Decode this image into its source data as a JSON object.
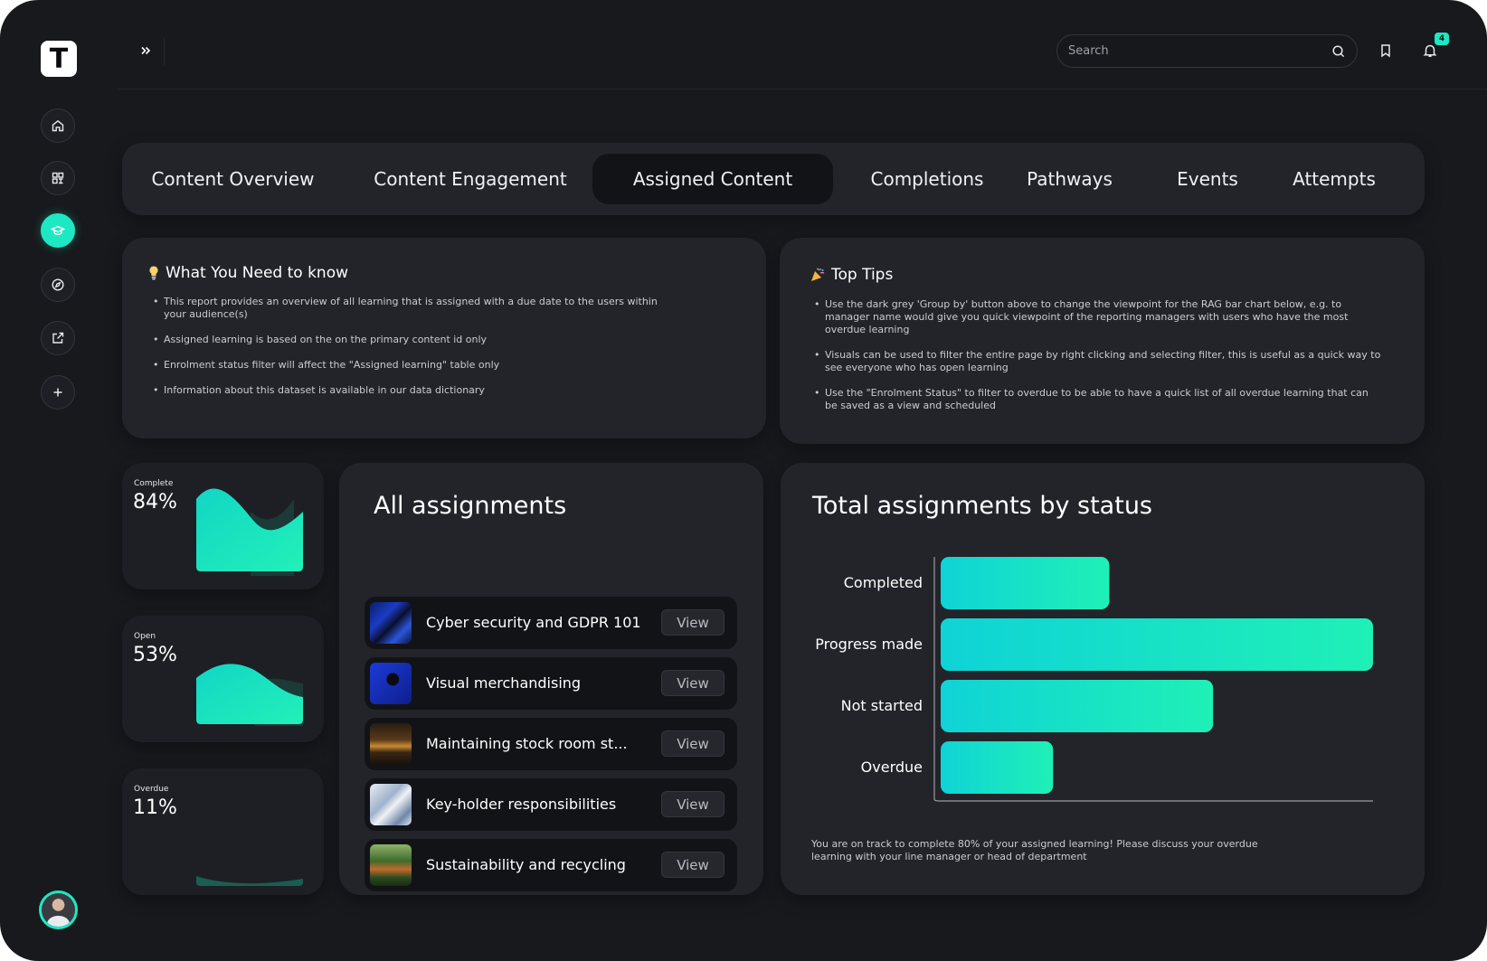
{
  "sidebar": {
    "logo_letter": "T",
    "items": [
      {
        "icon": "home-icon"
      },
      {
        "icon": "dashboard-icon"
      },
      {
        "icon": "graduation-cap-icon",
        "active": true
      },
      {
        "icon": "compass-icon"
      },
      {
        "icon": "external-link-icon"
      },
      {
        "icon": "plus-icon"
      }
    ]
  },
  "topbar": {
    "search_placeholder": "Search",
    "notification_count": "4"
  },
  "tabs": [
    {
      "label": "Content Overview"
    },
    {
      "label": "Content Engagement"
    },
    {
      "label": "Assigned Content",
      "active": true
    },
    {
      "label": "Completions"
    },
    {
      "label": "Pathways"
    },
    {
      "label": "Events"
    },
    {
      "label": "Attempts"
    }
  ],
  "need_to_know": {
    "title": "What You Need to know",
    "items": [
      "This report provides an overview of all learning that is assigned with a due date to the users within your audience(s)",
      "Assigned learning is based on the on the primary content id only",
      "Enrolment status filter will affect the \"Assigned learning\" table only",
      "Information about this dataset is available in our data dictionary"
    ]
  },
  "top_tips": {
    "title": "Top Tips",
    "items": [
      "Use the dark grey 'Group by' button above to change the viewpoint for the RAG bar chart below, e.g. to manager name would give you quick viewpoint of the reporting managers with users who have the most overdue learning",
      "Visuals can be used to filter the entire page by right clicking and selecting filter, this is useful as a quick way to see everyone who has open learning",
      "Use the \"Enrolment Status\" to filter to overdue to be able to have a quick list of all overdue learning that can be saved as a view and scheduled"
    ]
  },
  "stats": [
    {
      "label": "Complete",
      "value": "84%",
      "level": 0.84
    },
    {
      "label": "Open",
      "value": "53%",
      "level": 0.53
    },
    {
      "label": "Overdue",
      "value": "11%",
      "level": 0.11
    }
  ],
  "assignments": {
    "title": "All assignments",
    "view_label": "View",
    "items": [
      {
        "name": "Cyber security and GDPR 101"
      },
      {
        "name": "Visual merchandising"
      },
      {
        "name": "Maintaining stock room st..."
      },
      {
        "name": "Key-holder responsibilities"
      },
      {
        "name": "Sustainability and recycling"
      }
    ]
  },
  "status_chart": {
    "title": "Total assignments by status",
    "footnote": "You are on track to complete 80% of your assigned learning! Please discuss your overdue learning with your line manager or head of department"
  },
  "chart_data": {
    "type": "bar",
    "orientation": "horizontal",
    "title": "Total assignments by status",
    "categories": [
      "Completed",
      "Progress made",
      "Not started",
      "Overdue"
    ],
    "values": [
      39,
      100,
      63,
      26
    ],
    "colors": [
      "#1ee8c3",
      "#0fd1d8"
    ],
    "grid": false
  },
  "colors": {
    "accent": "#1ee8c3",
    "background": "#18191d",
    "card": "#23242a"
  }
}
